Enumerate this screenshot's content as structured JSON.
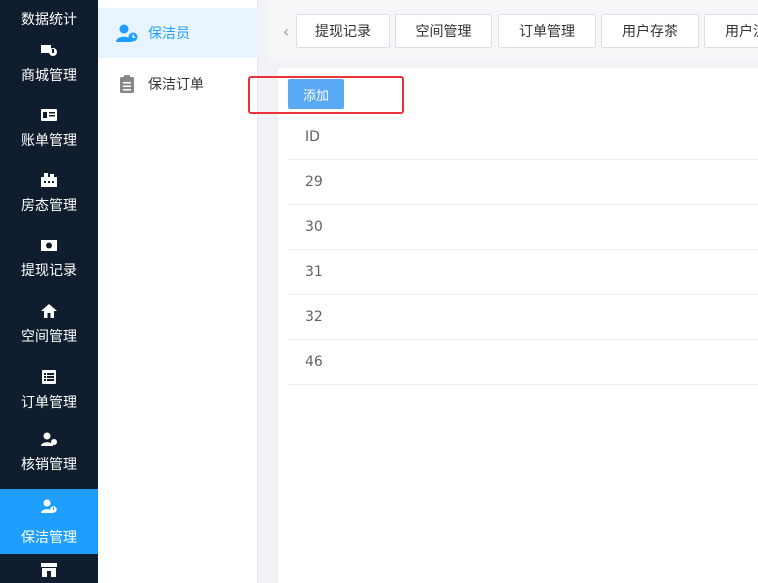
{
  "nav": {
    "top_label": "数据统计",
    "items": [
      {
        "label": "商城管理",
        "icon": "shop-cart-icon"
      },
      {
        "label": "账单管理",
        "icon": "bill-card-icon"
      },
      {
        "label": "房态管理",
        "icon": "building-icon"
      },
      {
        "label": "提现记录",
        "icon": "money-icon"
      },
      {
        "label": "空间管理",
        "icon": "home-icon"
      },
      {
        "label": "订单管理",
        "icon": "list-icon"
      },
      {
        "label": "核销管理",
        "icon": "user-verify-icon"
      },
      {
        "label": "保洁管理",
        "icon": "user-clock-icon"
      }
    ],
    "bottom_icon": "store-icon",
    "active_color": "#1e9fff"
  },
  "submenu": {
    "items": [
      {
        "label": "保洁员",
        "icon": "user-clock-icon"
      },
      {
        "label": "保洁订单",
        "icon": "clipboard-icon"
      }
    ]
  },
  "tabs": {
    "items": [
      "提现记录",
      "空间管理",
      "订单管理",
      "用户存茶",
      "用户流"
    ]
  },
  "toolbar": {
    "add_label": "添加"
  },
  "table": {
    "header": "ID",
    "rows": [
      "29",
      "30",
      "31",
      "32",
      "46"
    ]
  }
}
